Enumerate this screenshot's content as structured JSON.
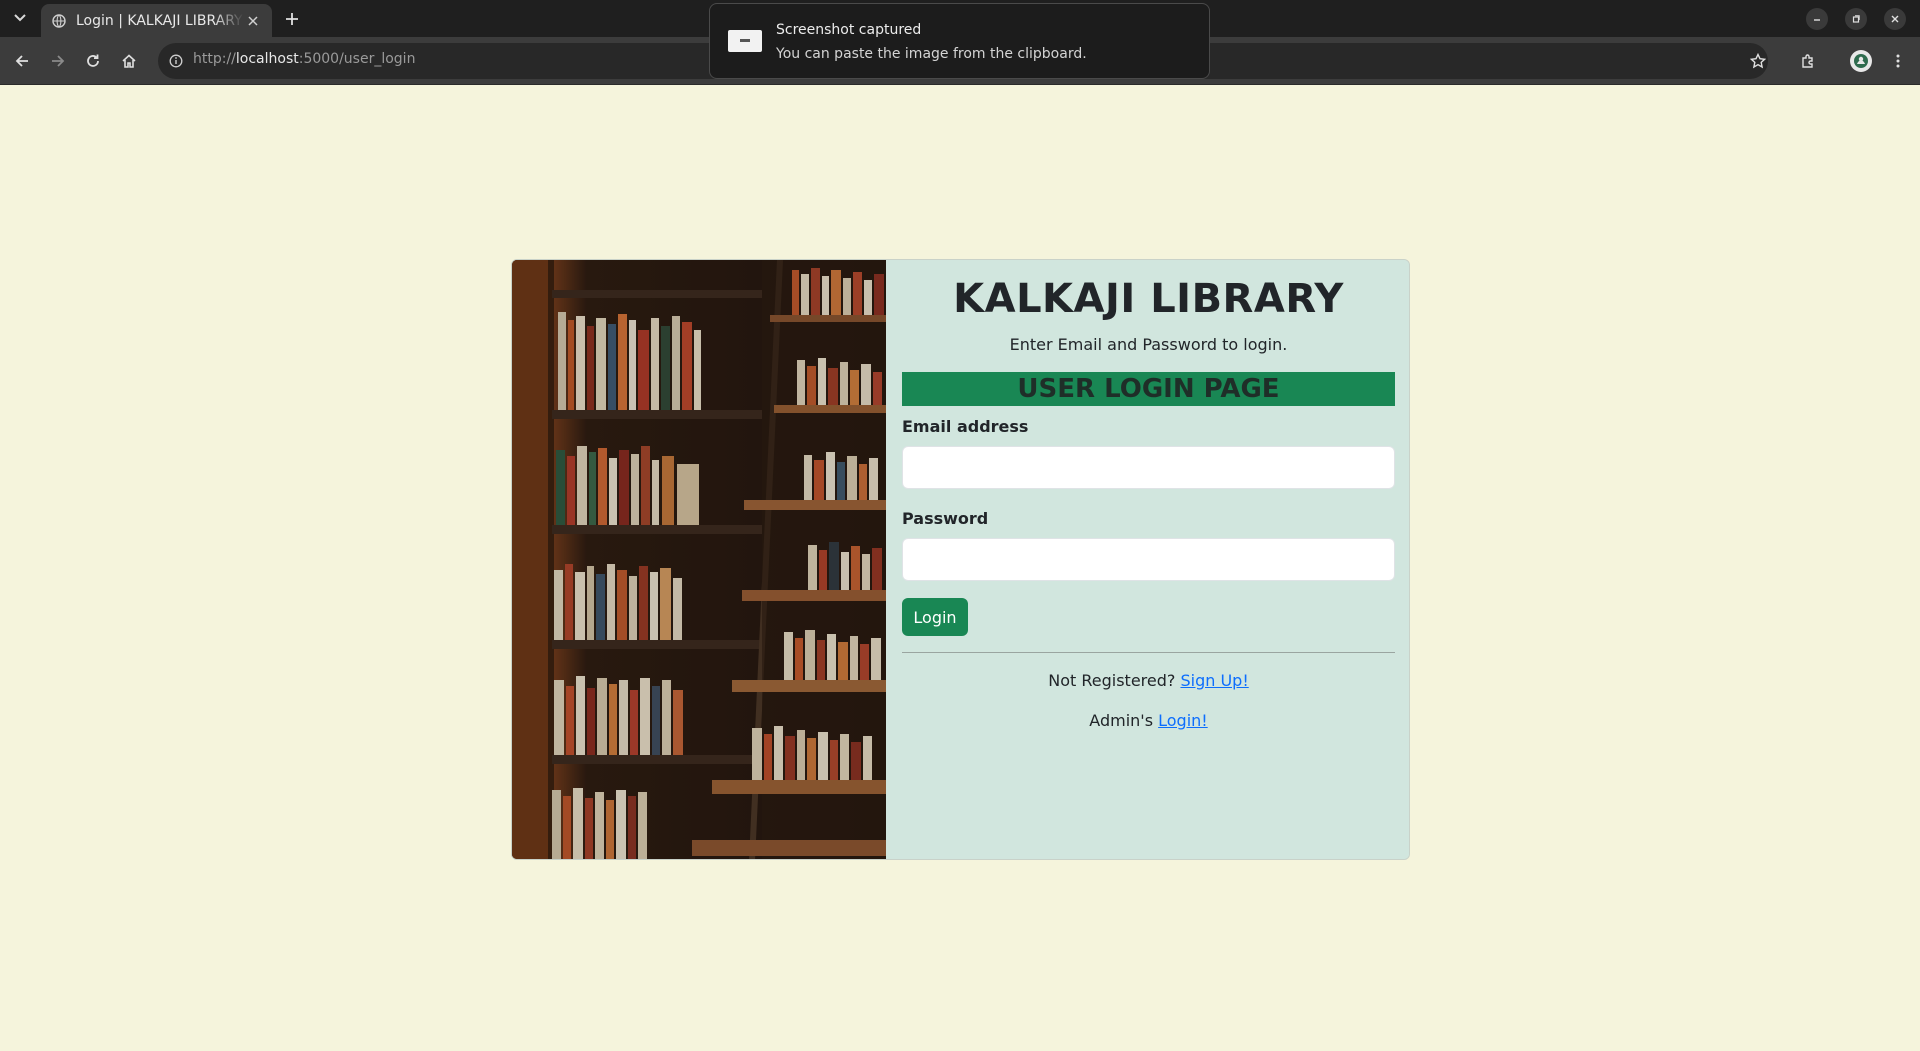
{
  "browser": {
    "tab_title": "Login | KALKAJI LIBRARY",
    "url_scheme": "http://",
    "url_host": "localhost",
    "url_rest": ":5000/user_login",
    "icons": [
      "tab-list-icon",
      "globe-icon",
      "close-icon",
      "plus-icon",
      "back-icon",
      "forward-icon",
      "reload-icon",
      "home-icon",
      "info-icon",
      "star-icon",
      "extensions-icon",
      "profile-icon",
      "menu-icon",
      "minimize-icon",
      "restore-icon",
      "window-close-icon"
    ]
  },
  "notification": {
    "title": "Screenshot captured",
    "body": "You can paste the image from the clipboard."
  },
  "login": {
    "brand": "KALKAJI LIBRARY",
    "subtitle": "Enter Email and Password to login.",
    "banner": "USER LOGIN PAGE",
    "email_label": "Email address",
    "email_value": "",
    "password_label": "Password",
    "password_value": "",
    "login_button": "Login",
    "not_registered_text": "Not Registered?",
    "signup_link": "Sign Up!",
    "admin_text": "Admin's",
    "admin_link": "Login!"
  },
  "colors": {
    "page_bg": "#f5f4dc",
    "panel_bg": "#d1e6de",
    "accent_green": "#198754",
    "link_blue": "#0d6efd"
  }
}
